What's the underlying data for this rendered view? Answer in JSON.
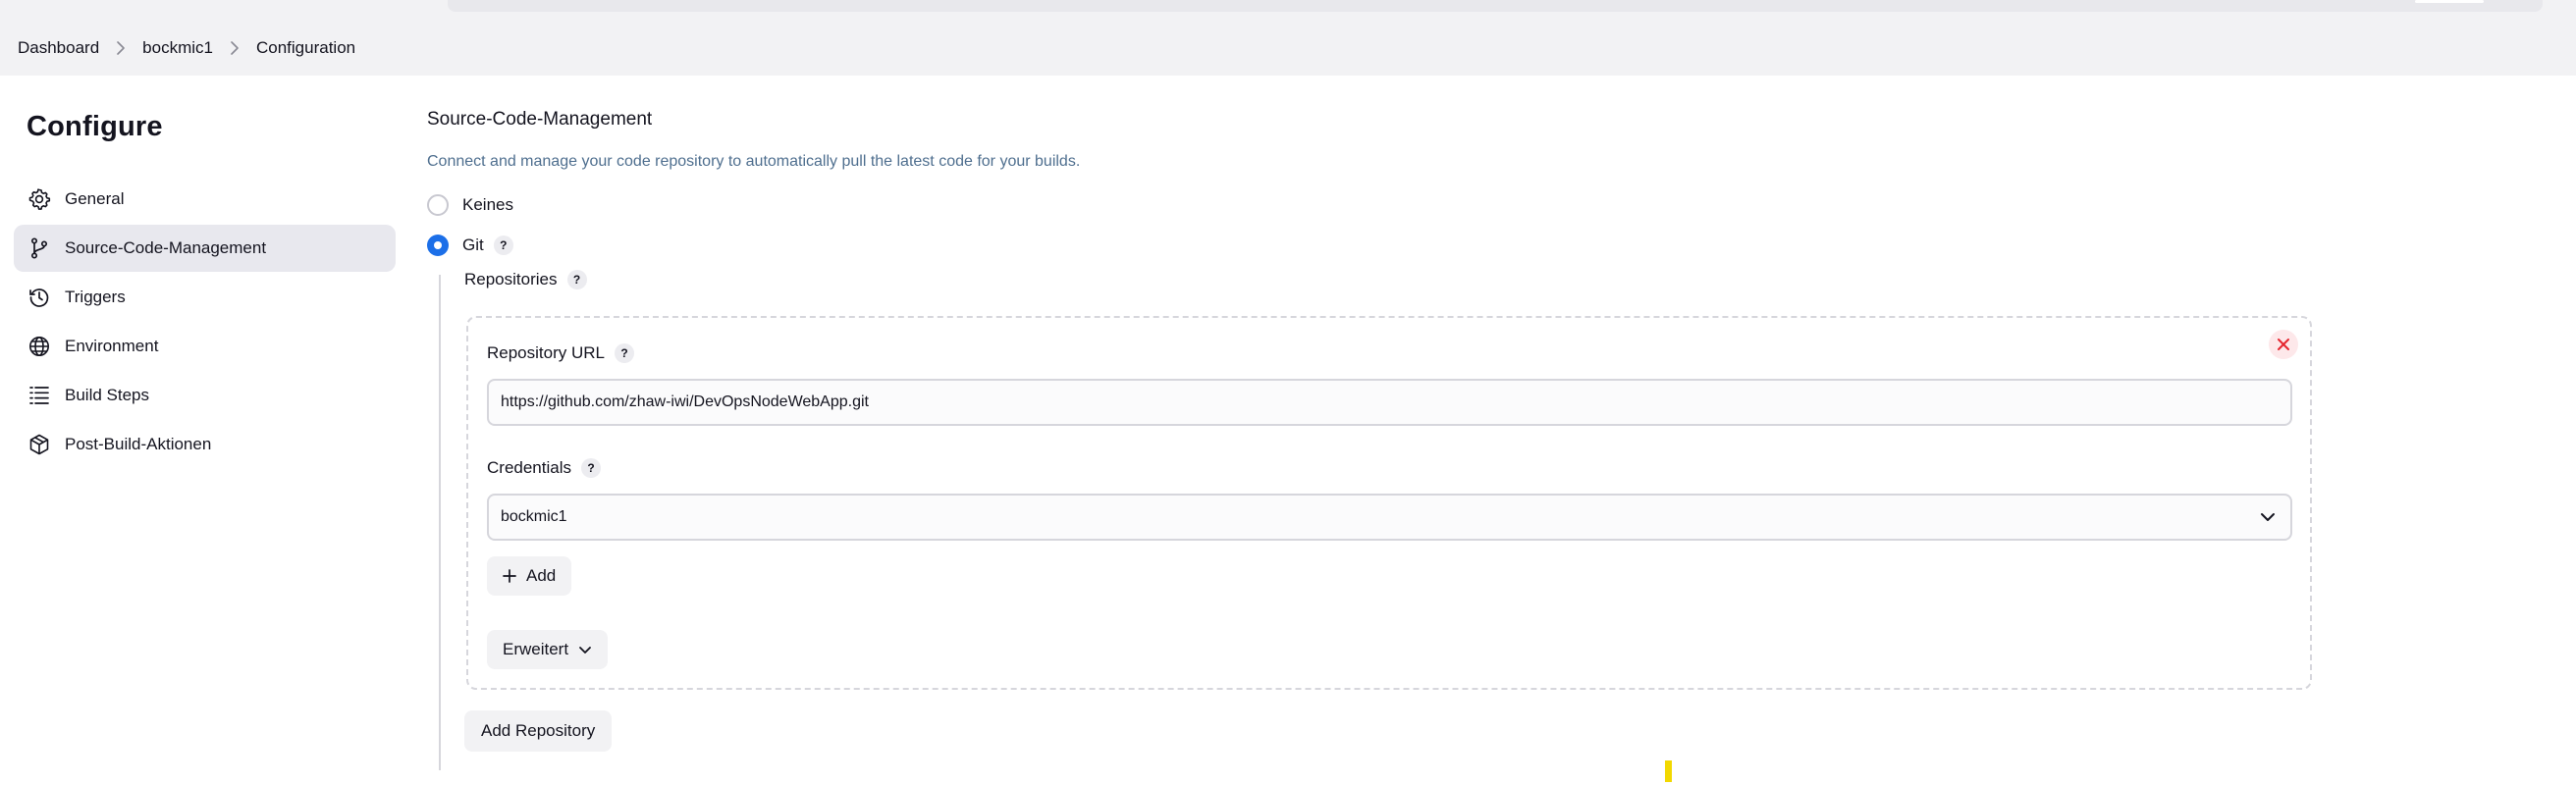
{
  "breadcrumb": [
    "Dashboard",
    "bockmic1",
    "Configuration"
  ],
  "sidebar": {
    "title": "Configure",
    "items": [
      {
        "label": "General",
        "icon": "gear-icon",
        "active": false
      },
      {
        "label": "Source-Code-Management",
        "icon": "git-branch-icon",
        "active": true
      },
      {
        "label": "Triggers",
        "icon": "clock-icon",
        "active": false
      },
      {
        "label": "Environment",
        "icon": "globe-icon",
        "active": false
      },
      {
        "label": "Build Steps",
        "icon": "list-icon",
        "active": false
      },
      {
        "label": "Post-Build-Aktionen",
        "icon": "cube-icon",
        "active": false
      }
    ]
  },
  "scm": {
    "title": "Source-Code-Management",
    "description": "Connect and manage your code repository to automatically pull the latest code for your builds.",
    "options": [
      {
        "label": "Keines",
        "selected": false
      },
      {
        "label": "Git",
        "selected": true
      }
    ],
    "repositories_label": "Repositories",
    "repository": {
      "url_label": "Repository URL",
      "url_value": "https://github.com/zhaw-iwi/DevOpsNodeWebApp.git",
      "credentials_label": "Credentials",
      "credentials_value": "bockmic1",
      "add_label": "Add",
      "advanced_label": "Erweitert"
    },
    "add_repository_label": "Add Repository"
  },
  "colors": {
    "accent": "#1c6fe8",
    "description_text": "#4f6f8f",
    "danger": "#e5262f",
    "marker": "#f2d800"
  }
}
